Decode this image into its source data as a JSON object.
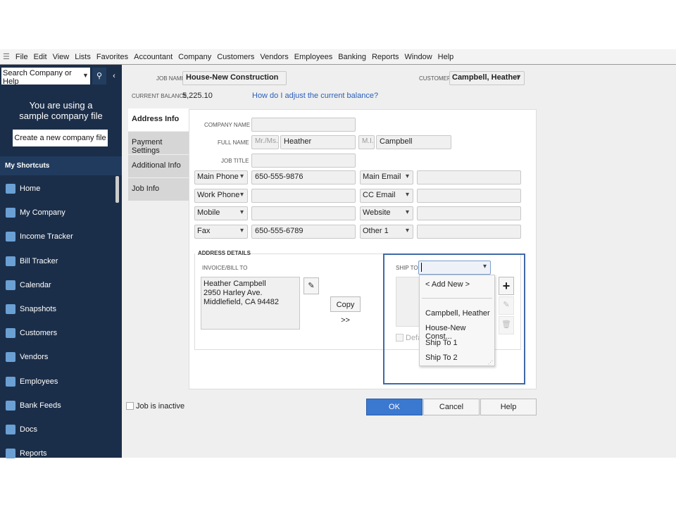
{
  "menu": [
    "File",
    "Edit",
    "View",
    "Lists",
    "Favorites",
    "Accountant",
    "Company",
    "Customers",
    "Vendors",
    "Employees",
    "Banking",
    "Reports",
    "Window",
    "Help"
  ],
  "sidebar": {
    "search_placeholder": "Search Company or Help",
    "sample_text": "You are using a sample company file",
    "create_button": "Create a new company file",
    "shortcuts_header": "My Shortcuts",
    "items": [
      "Home",
      "My Company",
      "Income Tracker",
      "Bill Tracker",
      "Calendar",
      "Snapshots",
      "Customers",
      "Vendors",
      "Employees",
      "Bank Feeds",
      "Docs",
      "Reports"
    ]
  },
  "header": {
    "job_name_label": "JOB NAME",
    "job_name": "House-New Construction",
    "customer_label": "CUSTOMER",
    "customer": "Campbell, Heather",
    "balance_label": "CURRENT BALANCE",
    "balance": "5,225.10",
    "balance_link": "How do I adjust the current balance?"
  },
  "tabs": [
    "Address Info",
    "Payment Settings",
    "Additional Info",
    "Job Info"
  ],
  "form": {
    "company_name_label": "COMPANY NAME",
    "company_name": "",
    "full_name_label": "FULL NAME",
    "salutation_placeholder": "Mr./Ms./...",
    "first_name": "Heather",
    "mi_placeholder": "M.I.",
    "last_name": "Campbell",
    "job_title_label": "JOB TITLE",
    "job_title": "",
    "left_contacts": [
      {
        "type": "Main Phone",
        "value": "650-555-9876"
      },
      {
        "type": "Work Phone",
        "value": ""
      },
      {
        "type": "Mobile",
        "value": ""
      },
      {
        "type": "Fax",
        "value": "650-555-6789"
      }
    ],
    "right_contacts": [
      {
        "type": "Main Email",
        "value": ""
      },
      {
        "type": "CC Email",
        "value": ""
      },
      {
        "type": "Website",
        "value": ""
      },
      {
        "type": "Other 1",
        "value": ""
      }
    ]
  },
  "address": {
    "section_label": "ADDRESS DETAILS",
    "bill_label": "INVOICE/BILL TO",
    "bill_lines": [
      "Heather Campbell",
      "2950 Harley Ave.",
      "Middlefield, CA 94482"
    ],
    "copy_button": "Copy >>",
    "ship_label": "SHIP TO",
    "ship_value": "",
    "default_label": "Default shipping address",
    "ship_options": [
      "< Add New >",
      "Campbell, Heather",
      "House-New Const...",
      "Ship To 1",
      "Ship To 2"
    ]
  },
  "footer": {
    "inactive_label": "Job is inactive",
    "ok": "OK",
    "cancel": "Cancel",
    "help": "Help"
  },
  "colors": {
    "sidebar": "#1b2e49",
    "ok_button": "#3b78d0",
    "highlight_box": "#3d6aa8",
    "link": "#2b5fb8"
  }
}
